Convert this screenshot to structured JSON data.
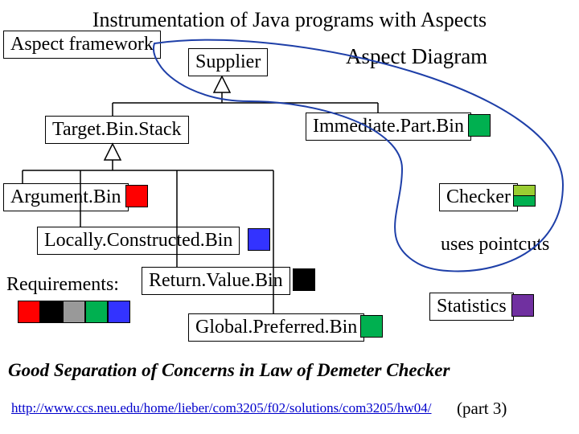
{
  "title": "Instrumentation of Java programs with Aspects",
  "labels": {
    "aspect_framework": "Aspect framework",
    "aspect_diagram": "Aspect Diagram",
    "supplier": "Supplier",
    "target_bin_stack": "Target.Bin.Stack",
    "immediate_part_bin": "Immediate.Part.Bin",
    "argument_bin": "Argument.Bin",
    "checker": "Checker",
    "locally_constructed_bin": "Locally.Constructed.Bin",
    "uses_pointcuts": "uses pointcuts",
    "requirements": "Requirements:",
    "return_value_bin": "Return.Value.Bin",
    "global_preferred_bin": "Global.Preferred.Bin",
    "statistics": "Statistics"
  },
  "swatches": {
    "immediate": "#00b050",
    "argument": "#ff0000",
    "locally": "#3333ff",
    "checker1": "#9acd32",
    "checker2": "#00b050",
    "return": "#000000",
    "global": "#00b050",
    "statistics": "#7030a0",
    "req1": "#ff0000",
    "req2": "#000000",
    "req3": "#999999",
    "req4": "#00b050",
    "req5": "#3333ff"
  },
  "caption": "Good Separation of Concerns in Law of Demeter Checker",
  "footer": {
    "link_text": "http://www.ccs.neu.edu/home/lieber/com3205/f02/solutions/com3205/hw04/",
    "url": "http://www.ccs.neu.edu/home/lieber/com3205/f02/solutions/com3205/hw04/",
    "part": "(part 3)"
  }
}
